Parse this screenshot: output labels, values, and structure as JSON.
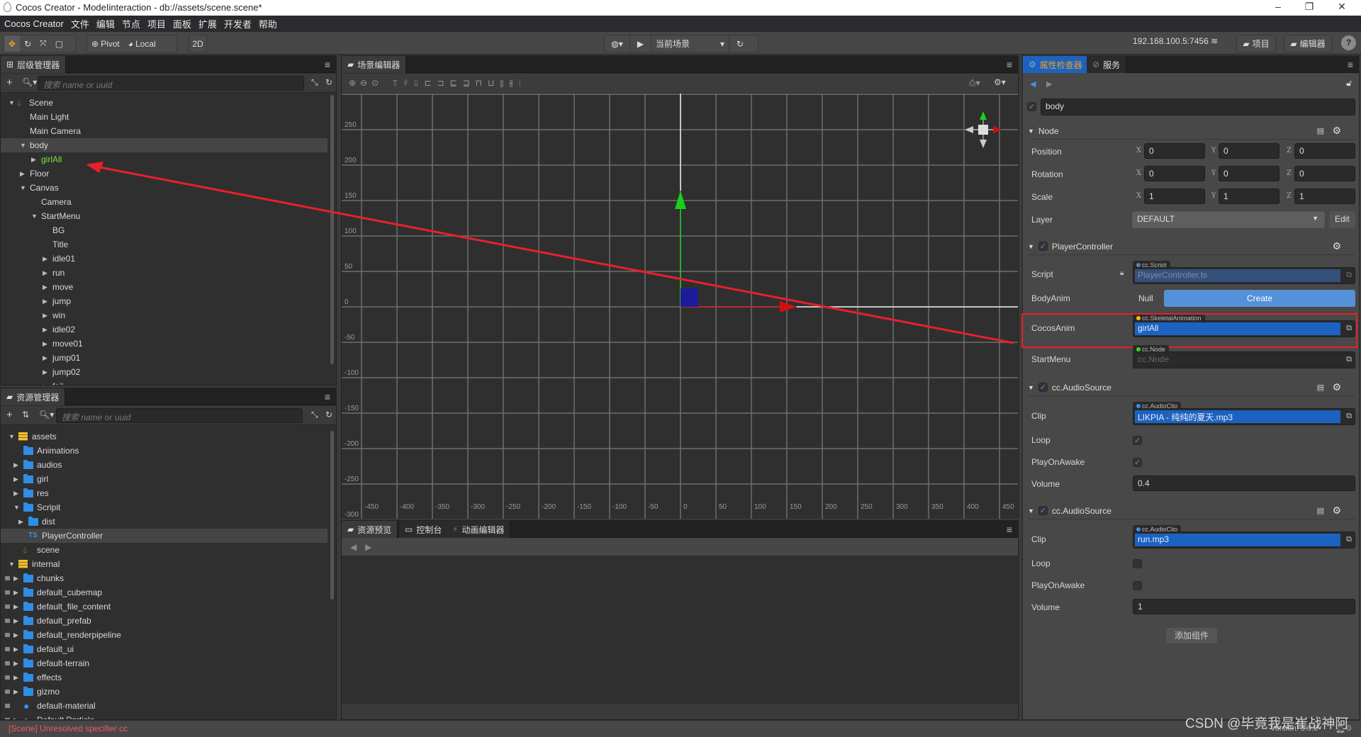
{
  "window": {
    "title": "Cocos Creator - ModeIinteraction - db://assets/scene.scene*"
  },
  "menu": [
    "Cocos Creator",
    "文件",
    "编辑",
    "节点",
    "项目",
    "面板",
    "扩展",
    "开发者",
    "帮助"
  ],
  "toolbar": {
    "pivot": "Pivot",
    "local": "Local",
    "mode2d": "2D",
    "scene_select": "当前场景",
    "ip": "192.168.100.5:7456",
    "project": "项目",
    "editor": "编辑器",
    "help": "?"
  },
  "hierarchy": {
    "title": "层级管理器",
    "search_placeholder": "搜索 name or uuid",
    "items": [
      {
        "label": "Scene",
        "depth": 0,
        "arrow": "open",
        "icon": "scene"
      },
      {
        "label": "Main Light",
        "depth": 1
      },
      {
        "label": "Main Camera",
        "depth": 1
      },
      {
        "label": "body",
        "depth": 1,
        "arrow": "open",
        "selected": true
      },
      {
        "label": "girlAll",
        "depth": 2,
        "arrow": "closed",
        "color": "#7fe03a"
      },
      {
        "label": "Floor",
        "depth": 1,
        "arrow": "closed"
      },
      {
        "label": "Canvas",
        "depth": 1,
        "arrow": "open"
      },
      {
        "label": "Camera",
        "depth": 2
      },
      {
        "label": "StartMenu",
        "depth": 2,
        "arrow": "open"
      },
      {
        "label": "BG",
        "depth": 3
      },
      {
        "label": "Title",
        "depth": 3
      },
      {
        "label": "idle01",
        "depth": 3,
        "arrow": "closed"
      },
      {
        "label": "run",
        "depth": 3,
        "arrow": "closed"
      },
      {
        "label": "move",
        "depth": 3,
        "arrow": "closed"
      },
      {
        "label": "jump",
        "depth": 3,
        "arrow": "closed"
      },
      {
        "label": "win",
        "depth": 3,
        "arrow": "closed"
      },
      {
        "label": "idle02",
        "depth": 3,
        "arrow": "closed"
      },
      {
        "label": "move01",
        "depth": 3,
        "arrow": "closed"
      },
      {
        "label": "jump01",
        "depth": 3,
        "arrow": "closed"
      },
      {
        "label": "jump02",
        "depth": 3,
        "arrow": "closed"
      },
      {
        "label": "fail",
        "depth": 3,
        "arrow": "closed"
      }
    ]
  },
  "assets": {
    "title": "资源管理器",
    "search_placeholder": "搜索 name or uuid",
    "items": [
      {
        "label": "assets",
        "depth": 0,
        "arrow": "open",
        "icon": "db"
      },
      {
        "label": "Animations",
        "depth": 1,
        "icon": "folder"
      },
      {
        "label": "audios",
        "depth": 1,
        "arrow": "closed",
        "icon": "folder"
      },
      {
        "label": "girl",
        "depth": 1,
        "arrow": "closed",
        "icon": "folder"
      },
      {
        "label": "res",
        "depth": 1,
        "arrow": "closed",
        "icon": "folder"
      },
      {
        "label": "Scripit",
        "depth": 1,
        "arrow": "open",
        "icon": "folder"
      },
      {
        "label": "dist",
        "depth": 2,
        "arrow": "closed",
        "icon": "folder"
      },
      {
        "label": "PlayerController",
        "depth": 2,
        "icon": "ts",
        "selected": true
      },
      {
        "label": "scene",
        "depth": 1,
        "icon": "scene"
      },
      {
        "label": "internal",
        "depth": 0,
        "arrow": "open",
        "icon": "db"
      },
      {
        "label": "chunks",
        "depth": 1,
        "arrow": "closed",
        "icon": "folder",
        "locked": true
      },
      {
        "label": "default_cubemap",
        "depth": 1,
        "arrow": "closed",
        "icon": "folder",
        "locked": true
      },
      {
        "label": "default_file_content",
        "depth": 1,
        "arrow": "closed",
        "icon": "folder",
        "locked": true
      },
      {
        "label": "default_prefab",
        "depth": 1,
        "arrow": "closed",
        "icon": "folder",
        "locked": true
      },
      {
        "label": "default_renderpipeline",
        "depth": 1,
        "arrow": "closed",
        "icon": "folder",
        "locked": true
      },
      {
        "label": "default_ui",
        "depth": 1,
        "arrow": "closed",
        "icon": "folder",
        "locked": true
      },
      {
        "label": "default-terrain",
        "depth": 1,
        "arrow": "closed",
        "icon": "folder",
        "locked": true
      },
      {
        "label": "effects",
        "depth": 1,
        "arrow": "closed",
        "icon": "folder",
        "locked": true
      },
      {
        "label": "gizmo",
        "depth": 1,
        "arrow": "closed",
        "icon": "folder",
        "locked": true
      },
      {
        "label": "default-material",
        "depth": 1,
        "icon": "material",
        "locked": true
      },
      {
        "label": "Default Particle",
        "depth": 1,
        "arrow": "closed",
        "icon": "particle",
        "locked": true
      }
    ]
  },
  "scene_editor": {
    "title": "场景编辑器",
    "x_ticks": [
      -450,
      -400,
      -350,
      -300,
      -250,
      -200,
      -150,
      -100,
      -50,
      0,
      50,
      100,
      150,
      200,
      250,
      300,
      350,
      400,
      450
    ],
    "y_ticks": [
      250,
      200,
      150,
      100,
      50,
      0,
      -50,
      -100,
      -150,
      -200,
      -250,
      -300
    ]
  },
  "bottom_panel": {
    "tabs": [
      "资源预览",
      "控制台",
      "动画编辑器"
    ]
  },
  "inspector": {
    "tabs": [
      "属性检查器",
      "服务"
    ],
    "node_name": "body",
    "node": {
      "title": "Node",
      "position": [
        "0",
        "0",
        "0"
      ],
      "rotation": [
        "0",
        "0",
        "0"
      ],
      "scale": [
        "1",
        "1",
        "1"
      ],
      "layer": "DEFAULT",
      "edit": "Edit",
      "labels": {
        "position": "Position",
        "rotation": "Rotation",
        "scale": "Scale",
        "layer": "Layer"
      }
    },
    "player_controller": {
      "title": "PlayerController",
      "script_label": "Script",
      "script_type": "cc.Script",
      "script_value": "PlayerController.ts",
      "bodyanim_label": "BodyAnim",
      "bodyanim_value": "Null",
      "create": "Create",
      "cocosanim_label": "CocosAnim",
      "cocosanim_type": "cc.SkeletalAnimation",
      "cocosanim_value": "girlAll",
      "startmenu_label": "StartMenu",
      "startmenu_type": "cc.Node",
      "startmenu_value": "cc.Node"
    },
    "audio_sources": [
      {
        "title": "cc.AudioSource",
        "clip_label": "Clip",
        "clip_type": "cc.AudioClip",
        "clip": "LIKPIA - 纯纯的夏天.mp3",
        "loop_label": "Loop",
        "loop": true,
        "playonawake_label": "PlayOnAwake",
        "playonawake": true,
        "volume_label": "Volume",
        "volume": "0.4"
      },
      {
        "title": "cc.AudioSource",
        "clip_label": "Clip",
        "clip_type": "cc.AudioClip",
        "clip": "run.mp3",
        "loop_label": "Loop",
        "loop": false,
        "playonawake_label": "PlayOnAwake",
        "playonawake": false,
        "volume_label": "Volume",
        "volume": "1"
      }
    ],
    "add_component": "添加组件"
  },
  "status": {
    "message": "[Scene] Unresolved specifier cc",
    "version": "Version: 3.0.0",
    "notifications": "0"
  },
  "watermark": "CSDN @毕竟我是崔战神阿",
  "colors": {
    "accent": "#1c62c0",
    "highlight_box": "#e8202a",
    "error": "#f0585d",
    "selected_node": "#7fe03a"
  }
}
